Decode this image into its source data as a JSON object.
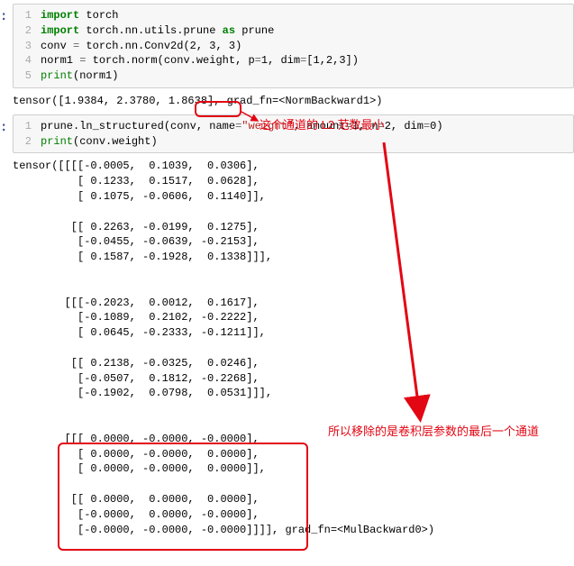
{
  "cell1": {
    "lines": [
      {
        "n": "1",
        "code": "<span class='kw'>import</span> <span class='nm'>torch</span>"
      },
      {
        "n": "2",
        "code": "<span class='kw'>import</span> <span class='nm'>torch.nn.utils.prune</span> <span class='kw'>as</span> <span class='nm'>prune</span>"
      },
      {
        "n": "3",
        "code": "<span class='nm'>conv</span> <span class='op'>=</span> <span class='nm'>torch.nn.Conv2d</span>(<span class='num'>2</span>, <span class='num'>3</span>, <span class='num'>3</span>)"
      },
      {
        "n": "4",
        "code": "<span class='nm'>norm1</span> <span class='op'>=</span> <span class='nm'>torch.norm</span>(<span class='nm'>conv.weight</span>, <span class='nm'>p</span><span class='op'>=</span><span class='num'>1</span>, <span class='nm'>dim</span><span class='op'>=</span>[<span class='num'>1</span>,<span class='num'>2</span>,<span class='num'>3</span>])"
      },
      {
        "n": "5",
        "code": "<span class='bi'>print</span>(<span class='nm'>norm1</span>)"
      }
    ]
  },
  "output1": "tensor([1.9384, 2.3780, 1.8638], grad_fn=<NormBackward1>)",
  "cell2": {
    "lines": [
      {
        "n": "1",
        "code": "<span class='nm'>prune.ln_structured</span>(<span class='nm'>conv</span>, <span class='nm'>name</span><span class='op'>=</span><span class='str'>\"weight\"</span>, <span class='nm'>amount</span><span class='op'>=</span><span class='num'>1</span>, <span class='nm'>n</span><span class='op'>=</span><span class='num'>2</span>, <span class='nm'>dim</span><span class='op'>=</span><span class='num'>0</span>)"
      },
      {
        "n": "2",
        "code": "<span class='bi'>print</span>(<span class='nm'>conv.weight</span>)"
      }
    ]
  },
  "output2": "tensor([[[[-0.0005,  0.1039,  0.0306],\n          [ 0.1233,  0.1517,  0.0628],\n          [ 0.1075, -0.0606,  0.1140]],\n\n         [[ 0.2263, -0.0199,  0.1275],\n          [-0.0455, -0.0639, -0.2153],\n          [ 0.1587, -0.1928,  0.1338]]],\n\n\n        [[[-0.2023,  0.0012,  0.1617],\n          [-0.1089,  0.2102, -0.2222],\n          [ 0.0645, -0.2333, -0.1211]],\n\n         [[ 0.2138, -0.0325,  0.0246],\n          [-0.0507,  0.1812, -0.2268],\n          [-0.1902,  0.0798,  0.0531]]],\n\n\n        [[[ 0.0000, -0.0000, -0.0000],\n          [ 0.0000, -0.0000,  0.0000],\n          [ 0.0000, -0.0000,  0.0000]],\n\n         [[ 0.0000,  0.0000,  0.0000],\n          [-0.0000,  0.0000, -0.0000],\n          [-0.0000, -0.0000, -0.0000]]]], grad_fn=<MulBackward0>)",
  "annotations": {
    "a1": "这个通道的 L2 范数最小",
    "a2": "所以移除的是卷积层参数的最后一个通道"
  },
  "prompt": ":"
}
